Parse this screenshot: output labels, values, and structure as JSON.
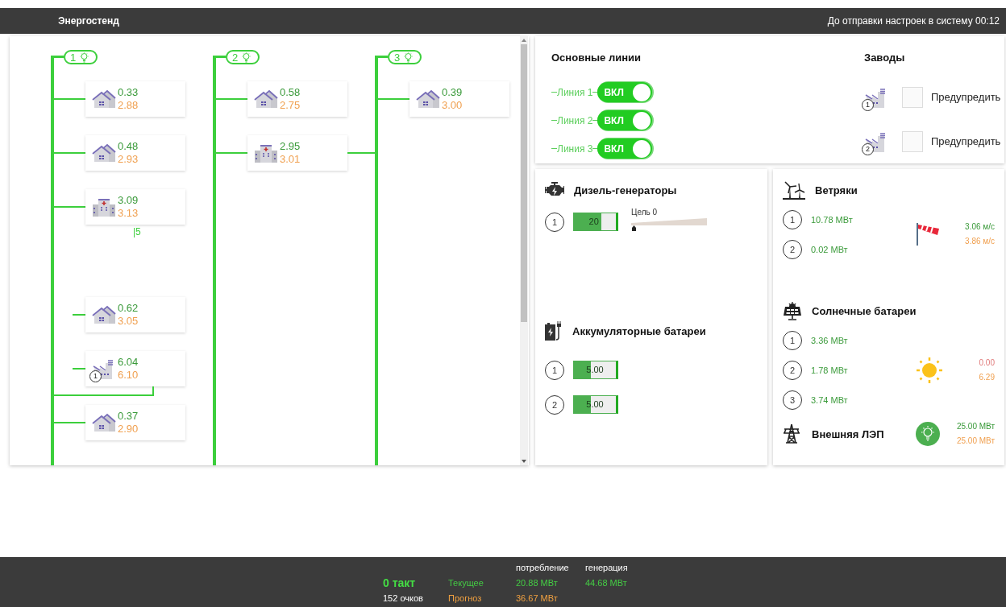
{
  "header": {
    "title": "Энергостенд",
    "countdown": "До отправки настроек в систему 00:12"
  },
  "lines": [
    {
      "label": "1",
      "items": [
        {
          "kind": "house",
          "consumption": "0.33",
          "forecast": "2.88",
          "connected": true
        },
        {
          "kind": "house",
          "consumption": "0.48",
          "forecast": "2.93",
          "connected": true
        },
        {
          "kind": "hospital",
          "consumption": "3.09",
          "forecast": "3.13",
          "connected": true,
          "note": "|5"
        },
        {
          "kind": "house",
          "consumption": "0.62",
          "forecast": "3.05",
          "connected": false,
          "after_gap": true
        },
        {
          "kind": "factory",
          "number": "1",
          "consumption": "6.04",
          "forecast": "6.10",
          "connected": false,
          "loop": true
        },
        {
          "kind": "house",
          "consumption": "0.37",
          "forecast": "2.90",
          "connected": true
        }
      ]
    },
    {
      "label": "2",
      "items": [
        {
          "kind": "house",
          "consumption": "0.58",
          "forecast": "2.75",
          "connected": true
        },
        {
          "kind": "hospital",
          "consumption": "2.95",
          "forecast": "3.01",
          "connected": true,
          "bridge": true
        }
      ]
    },
    {
      "label": "3",
      "items": [
        {
          "kind": "house",
          "consumption": "0.39",
          "forecast": "3.00",
          "connected": true
        }
      ]
    }
  ],
  "main_lines": {
    "title": "Основные линии",
    "items": [
      {
        "label": "Линия 1",
        "toggle": "ВКЛ",
        "on": true
      },
      {
        "label": "Линия 2",
        "toggle": "ВКЛ",
        "on": true
      },
      {
        "label": "Линия 3",
        "toggle": "ВКЛ",
        "on": true
      }
    ]
  },
  "plants": {
    "title": "Заводы",
    "items": [
      {
        "number": "1",
        "label": "Предупредить",
        "checked": false
      },
      {
        "number": "2",
        "label": "Предупредить",
        "checked": false
      }
    ]
  },
  "diesel": {
    "title": "Дизель-генераторы",
    "items": [
      {
        "number": "1",
        "value": "20",
        "level": 0.65
      }
    ],
    "slider": {
      "label": "Цель 0",
      "level": 0
    }
  },
  "batteries": {
    "title": "Аккумуляторные батареи",
    "items": [
      {
        "number": "1",
        "value": "5.00",
        "level": 0.41
      },
      {
        "number": "2",
        "value": "5.00",
        "level": 0.41
      }
    ]
  },
  "wind": {
    "title": "Ветряки",
    "items": [
      {
        "number": "1",
        "power": "10.78 МВт"
      },
      {
        "number": "2",
        "power": "0.02 МВт"
      }
    ],
    "speed": "3.06 м/с",
    "speed_forecast": "3.86 м/с"
  },
  "solar": {
    "title": "Солнечные батареи",
    "items": [
      {
        "number": "1",
        "power": "3.36 МВт"
      },
      {
        "number": "2",
        "power": "1.78 МВт"
      },
      {
        "number": "3",
        "power": "3.74 МВт"
      }
    ],
    "current": "0.00",
    "forecast": "6.29"
  },
  "external": {
    "title": "Внешняя ЛЭП",
    "current": "25.00 МВт",
    "forecast": "25.00 МВт"
  },
  "footer": {
    "tick": "0 такт",
    "score": "152 очков",
    "headers": [
      "потребление",
      "генерация"
    ],
    "current": {
      "label": "Текущее",
      "values": [
        "20.88 МВт",
        "44.68 МВт"
      ]
    },
    "forecast": {
      "label": "Прогноз",
      "values": [
        "36.67 МВт"
      ]
    }
  }
}
